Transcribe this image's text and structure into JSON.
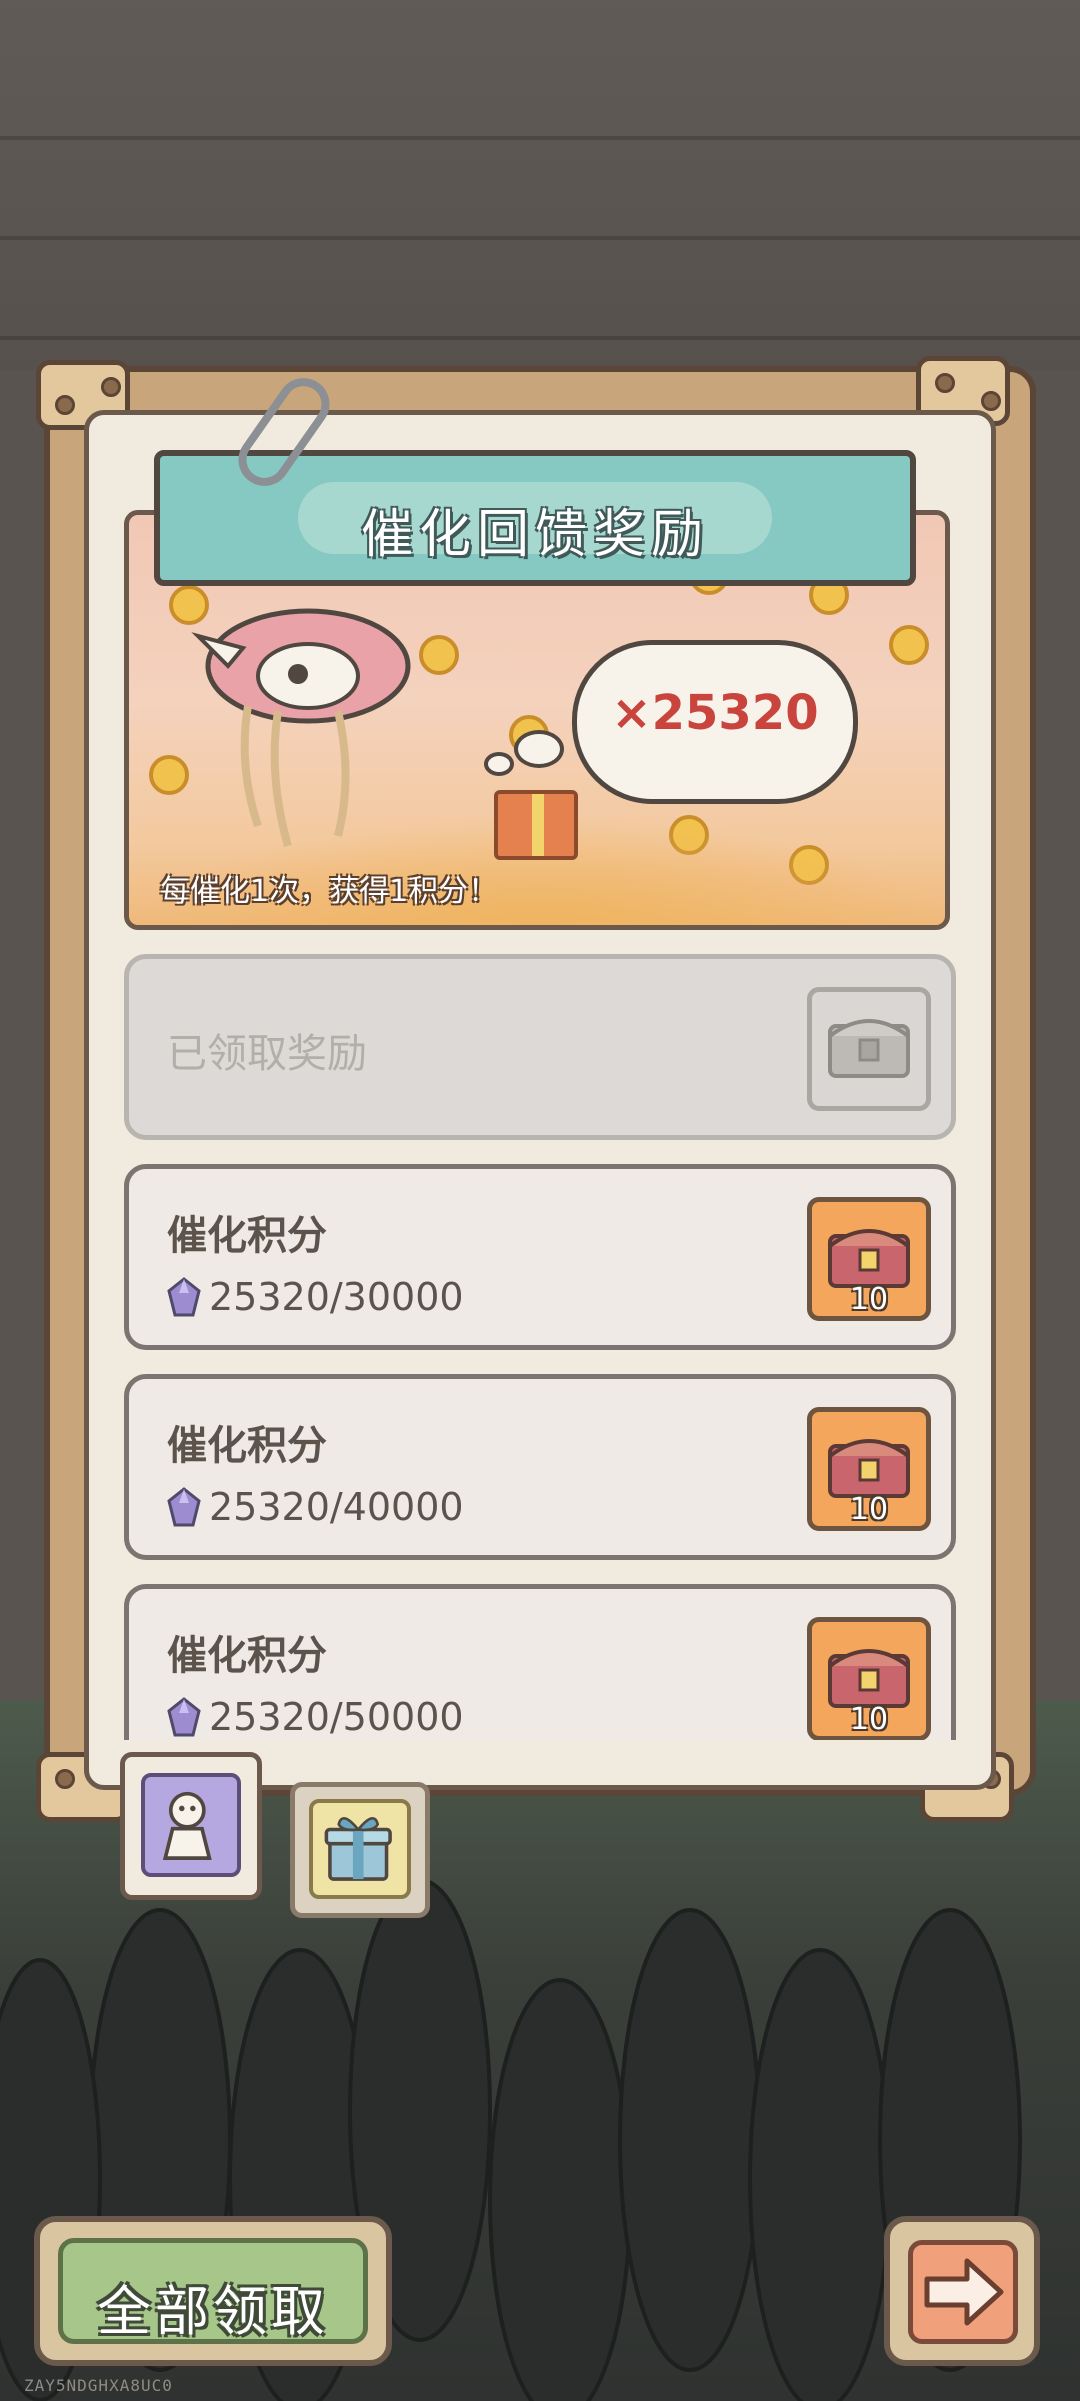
{
  "panel": {
    "title": "催化回馈奖励",
    "points_bubble": "×25320",
    "caption": "每催化1次，获得1积分！"
  },
  "rewards": [
    {
      "label": "已领取奖励",
      "status": "claimed",
      "chest_icon": "chest-icon"
    },
    {
      "label": "催化积分",
      "progress": "25320/30000",
      "current": 25320,
      "target": 30000,
      "chest_count": "10",
      "status": "locked",
      "chest_icon": "chest-icon"
    },
    {
      "label": "催化积分",
      "progress": "25320/40000",
      "current": 25320,
      "target": 40000,
      "chest_count": "10",
      "status": "locked",
      "chest_icon": "chest-icon"
    },
    {
      "label": "催化积分",
      "progress": "25320/50000",
      "current": 25320,
      "target": 50000,
      "chest_count": "10",
      "status": "locked",
      "chest_icon": "chest-icon"
    }
  ],
  "tabs": [
    {
      "icon": "doll-icon",
      "active": true
    },
    {
      "icon": "gift-box-icon",
      "active": false
    }
  ],
  "buttons": {
    "claim_all": "全部领取",
    "next_icon": "arrow-right-icon"
  },
  "watermark": "ZAY5NDGHXA8UC0",
  "colors": {
    "title_bar": "#86c9c2",
    "points_text": "#c9443d",
    "claim_button": "#a7c78a",
    "chest_slot_active": "#f3a65c",
    "next_button": "#f0a07a"
  }
}
